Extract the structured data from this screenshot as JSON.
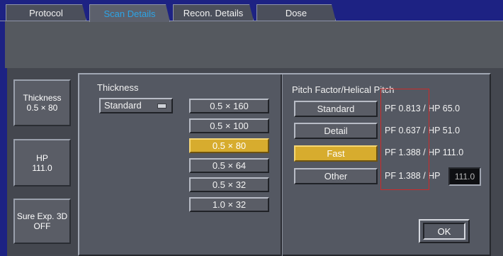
{
  "tabs": [
    {
      "label": "Protocol",
      "active": false
    },
    {
      "label": "Scan Details",
      "active": true
    },
    {
      "label": "Recon. Details",
      "active": false
    },
    {
      "label": "Dose",
      "active": false
    }
  ],
  "sidebar": {
    "thickness": {
      "line1": "Thickness",
      "line2": "0.5 × 80"
    },
    "hp": {
      "line1": "HP",
      "line2": "111.0"
    },
    "sure_exp": {
      "line1": "Sure Exp. 3D",
      "line2": "OFF"
    }
  },
  "thickness_panel": {
    "title": "Thickness",
    "dropdown_value": "Standard",
    "options": [
      {
        "label": "0.5 × 160",
        "selected": false
      },
      {
        "label": "0.5 × 100",
        "selected": false
      },
      {
        "label": "0.5 × 80",
        "selected": true
      },
      {
        "label": "0.5 × 64",
        "selected": false
      },
      {
        "label": "0.5 × 32",
        "selected": false
      },
      {
        "label": "1.0 × 32",
        "selected": false
      }
    ]
  },
  "pitch_panel": {
    "title": "Pitch Factor/Helical Pitch",
    "options": [
      {
        "label": "Standard",
        "value": "PF 0.813 / HP 65.0",
        "selected": false
      },
      {
        "label": "Detail",
        "value": "PF 0.637 / HP 51.0",
        "selected": false
      },
      {
        "label": "Fast",
        "value": "PF 1.388 / HP 111.0",
        "selected": true
      },
      {
        "label": "Other",
        "value": "PF 1.388 / HP",
        "selected": false
      }
    ],
    "hp_field_value": "111.0"
  },
  "ok_label": "OK",
  "colors": {
    "background": "#1d2283",
    "selected": "#d7ac2e",
    "active_tab_text": "#2da4e6",
    "highlight_box": "#cc2a2a"
  }
}
